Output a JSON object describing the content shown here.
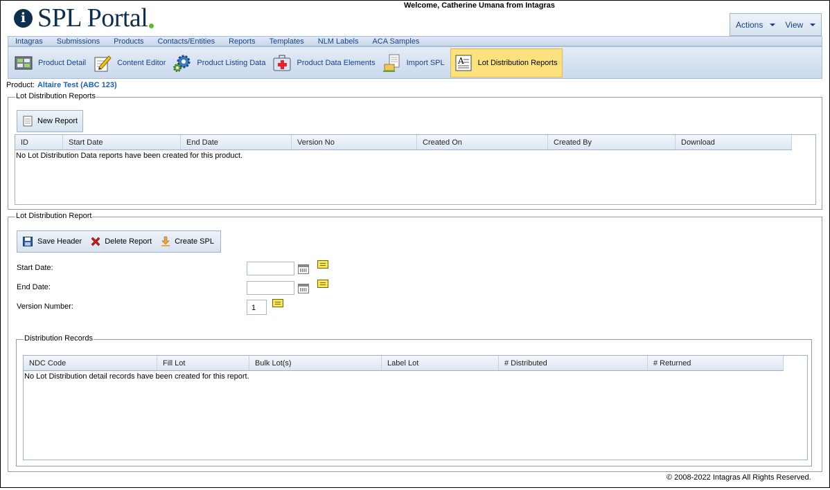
{
  "header": {
    "logo_text": "SPL Portal",
    "logo_mark": "i",
    "welcome": "Welcome, Catherine Umana from Intagras",
    "actions_label": "Actions",
    "view_label": "View"
  },
  "menu": [
    "Intagras",
    "Submissions",
    "Products",
    "Contacts/Entities",
    "Reports",
    "Templates",
    "NLM Labels",
    "ACA Samples"
  ],
  "toolbar": [
    {
      "label": "Product Detail",
      "icon": "product-detail-icon"
    },
    {
      "label": "Content Editor",
      "icon": "content-editor-icon"
    },
    {
      "label": "Product Listing Data",
      "icon": "gear-icon"
    },
    {
      "label": "Product Data Elements",
      "icon": "medical-kit-icon"
    },
    {
      "label": "Import SPL",
      "icon": "import-document-icon"
    },
    {
      "label": "Lot Distribution Reports",
      "icon": "document-a-icon",
      "active": true
    }
  ],
  "product": {
    "label": "Product:",
    "value": "Altaire Test (ABC 123)"
  },
  "reports_panel": {
    "legend": "Lot Distribution Reports",
    "new_report": "New Report",
    "columns": [
      "ID",
      "Start Date",
      "End Date",
      "Version No",
      "Created On",
      "Created By",
      "Download"
    ],
    "empty_message": "No Lot Distribution Data reports have been created for this product."
  },
  "report_panel": {
    "legend": "Lot Distribution Report",
    "save_header": "Save Header",
    "delete_report": "Delete Report",
    "create_spl": "Create SPL",
    "start_date_label": "Start Date:",
    "start_date_value": "",
    "end_date_label": "End Date:",
    "end_date_value": "",
    "version_label": "Version Number:",
    "version_value": "1"
  },
  "records_panel": {
    "legend": "Distribution Records",
    "columns": [
      "NDC Code",
      "Fill Lot",
      "Bulk Lot(s)",
      "Label Lot",
      "# Distributed",
      "# Returned"
    ],
    "empty_message": "No Lot Distribution detail records have been created for this report."
  },
  "footer": {
    "copyright": "© 2008-2022 Intagras All Rights Reserved."
  },
  "colors": {
    "brand_navy": "#0d2f4f",
    "brand_green": "#5cb82e",
    "link_blue": "#15428b",
    "active_tab": "#fbe27f"
  }
}
